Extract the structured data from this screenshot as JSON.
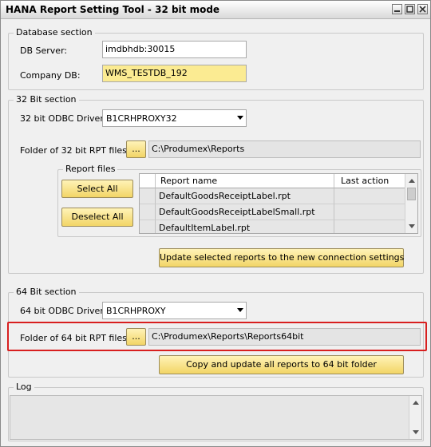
{
  "window": {
    "title": "HANA Report Setting Tool - 32 bit mode"
  },
  "database": {
    "legend": "Database section",
    "db_server_label": "DB Server:",
    "db_server_value": "imdbhdb:30015",
    "company_db_label": "Company DB:",
    "company_db_value": "WMS_TESTDB_192"
  },
  "section32": {
    "legend": "32 Bit section",
    "odbc_label": "32 bit ODBC Driver:",
    "odbc_value": "B1CRHPROXY32",
    "folder_label": "Folder of 32 bit RPT files:",
    "browse_label": "...",
    "folder_value": "C:\\Produmex\\Reports",
    "report_files_legend": "Report files",
    "select_all_label": "Select All",
    "deselect_all_label": "Deselect All",
    "columns": [
      "Report name",
      "Last action"
    ],
    "rows": [
      {
        "name": "DefaultGoodsReceiptLabel.rpt",
        "last_action": ""
      },
      {
        "name": "DefaultGoodsReceiptLabelSmall.rpt",
        "last_action": ""
      },
      {
        "name": "DefaultItemLabel.rpt",
        "last_action": ""
      }
    ],
    "update_button_label": "Update selected reports to the new connection settings"
  },
  "section64": {
    "legend": "64 Bit section",
    "odbc_label": "64 bit ODBC Driver:",
    "odbc_value": "B1CRHPROXY",
    "folder_label": "Folder of 64 bit RPT files:",
    "browse_label": "...",
    "folder_value": "C:\\Produmex\\Reports\\Reports64bit",
    "copy_button_label": "Copy and update all reports to 64 bit folder"
  },
  "log": {
    "legend": "Log",
    "text": ""
  },
  "colors": {
    "button_fill": "#f2d566",
    "highlight_border": "#d81f1f",
    "yellow_field": "#fbeb92"
  }
}
